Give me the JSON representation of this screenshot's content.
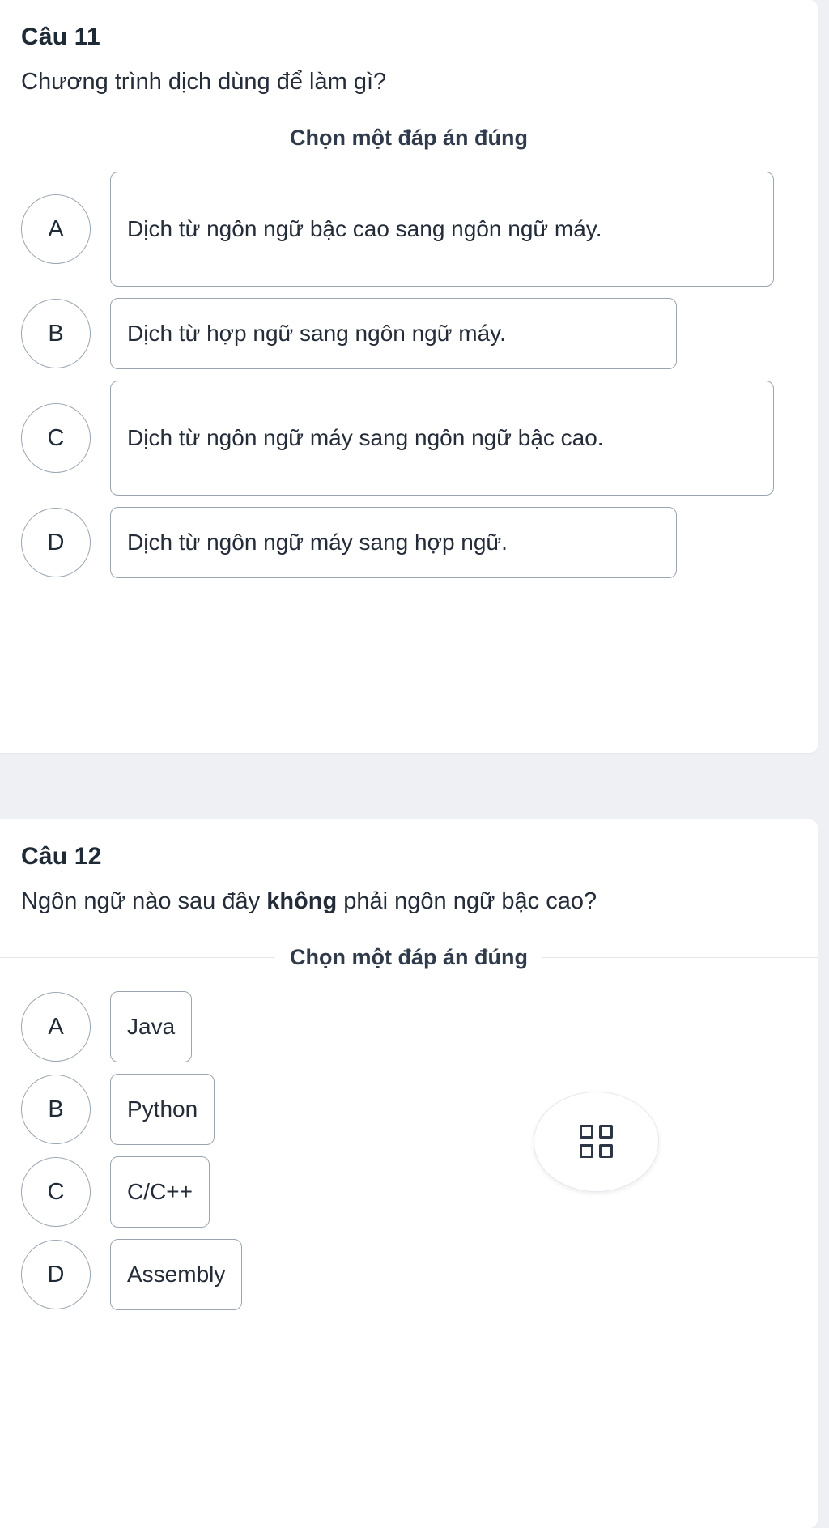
{
  "page": {
    "background_color": "#eef0f4",
    "card_background": "#ffffff"
  },
  "questions": [
    {
      "number_label": "Câu 11",
      "prompt": "Chương trình dịch dùng để làm gì?",
      "instruction": "Chọn một đáp án đúng",
      "options": [
        {
          "letter": "A",
          "text": "Dịch từ ngôn ngữ bậc cao sang ngôn ngữ máy."
        },
        {
          "letter": "B",
          "text": "Dịch từ hợp ngữ sang ngôn ngữ máy."
        },
        {
          "letter": "C",
          "text": "Dịch từ ngôn ngữ máy sang ngôn ngữ bậc cao."
        },
        {
          "letter": "D",
          "text": "Dịch từ ngôn ngữ máy sang hợp ngữ."
        }
      ]
    },
    {
      "number_label": "Câu 12",
      "prompt_before": "Ngôn ngữ nào sau đây ",
      "prompt_bold": "không",
      "prompt_after": " phải ngôn ngữ bậc cao?",
      "instruction": "Chọn một đáp án đúng",
      "options": [
        {
          "letter": "A",
          "text": "Java"
        },
        {
          "letter": "B",
          "text": "Python"
        },
        {
          "letter": "C",
          "text": "C/C++"
        },
        {
          "letter": "D",
          "text": "Assembly"
        }
      ]
    }
  ],
  "floating_button": {
    "icon": "grid-four-squares-icon"
  }
}
